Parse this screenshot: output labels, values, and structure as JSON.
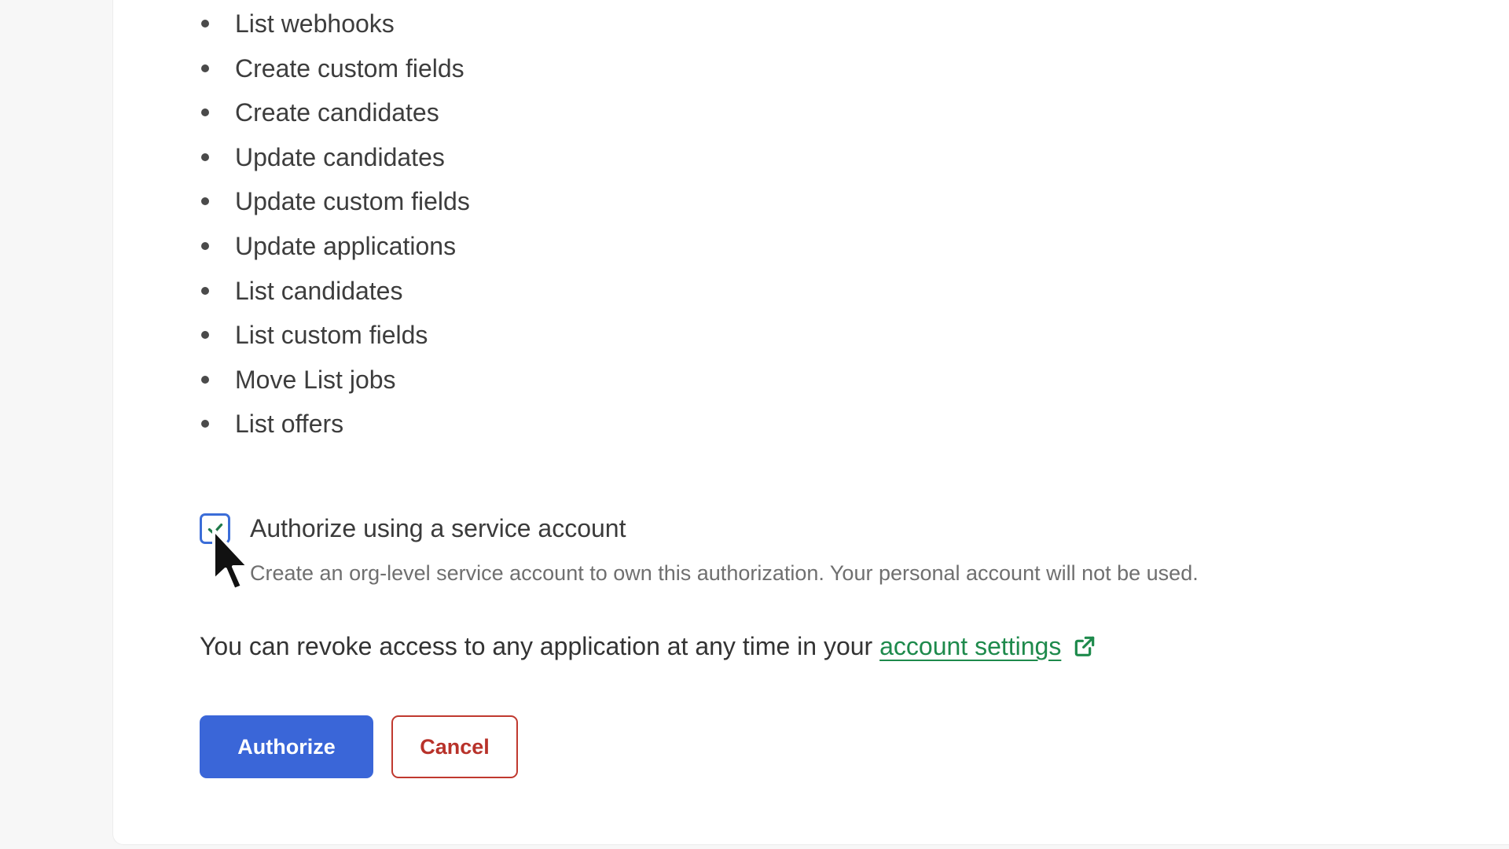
{
  "permissions": [
    "List webhooks",
    "Create custom fields",
    "Create candidates",
    "Update candidates",
    "Update custom fields",
    "Update applications",
    "List candidates",
    "List custom fields",
    "Move List jobs",
    "List offers"
  ],
  "service_account": {
    "checked": true,
    "label": "Authorize using a service account",
    "help": "Create an org-level service account to own this authorization. Your personal account will not be used."
  },
  "revoke": {
    "text": "You can revoke access to any application at any time in your ",
    "link_text": "account settings",
    "link_icon": "external-link-icon"
  },
  "actions": {
    "authorize_label": "Authorize",
    "cancel_label": "Cancel"
  },
  "colors": {
    "primary": "#3a66d8",
    "danger": "#c0392f",
    "link": "#1e8a4c"
  }
}
